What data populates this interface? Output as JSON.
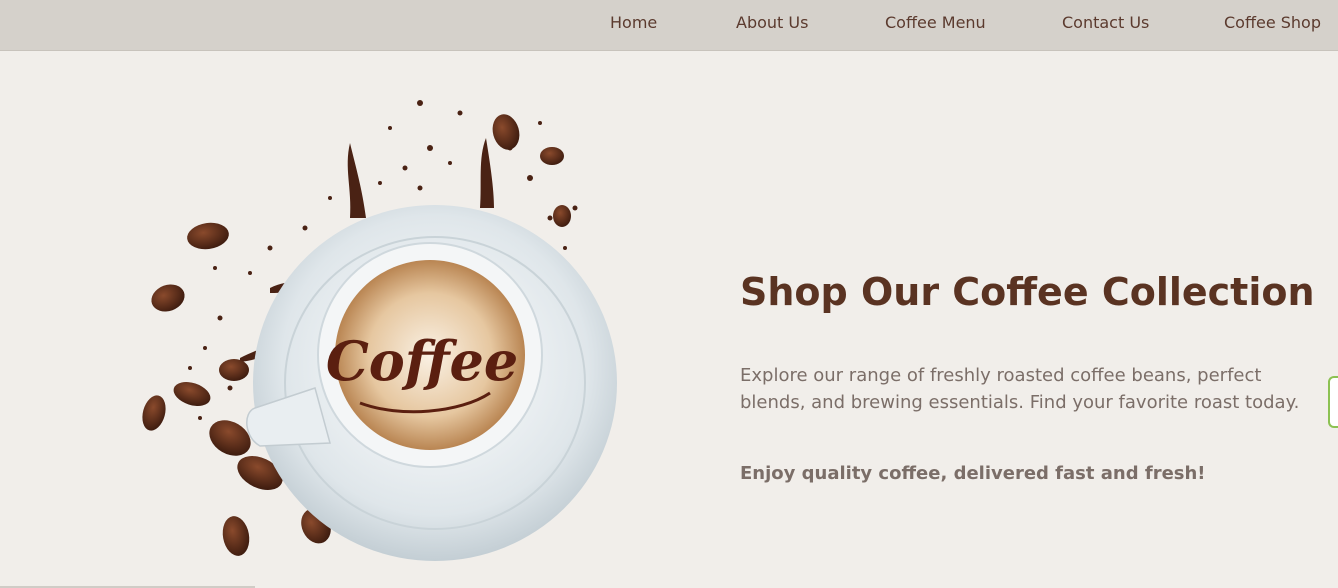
{
  "nav": {
    "items": [
      {
        "label": "Home"
      },
      {
        "label": "About Us"
      },
      {
        "label": "Coffee Menu"
      },
      {
        "label": "Contact Us"
      },
      {
        "label": "Coffee Shop"
      }
    ]
  },
  "hero": {
    "cup_lettering": "Coffee",
    "title": "Shop Our Coffee Collection",
    "description": "Explore our range of freshly roasted coffee beans, perfect blends, and brewing essentials. Find your favorite roast today.",
    "tagline": "Enjoy quality coffee, delivered fast and fresh!"
  },
  "colors": {
    "background": "#f1eeea",
    "navbar": "#d5d1cb",
    "nav_text": "#5b3a2e",
    "title": "#5a3322",
    "body_text": "#7b6e68"
  }
}
